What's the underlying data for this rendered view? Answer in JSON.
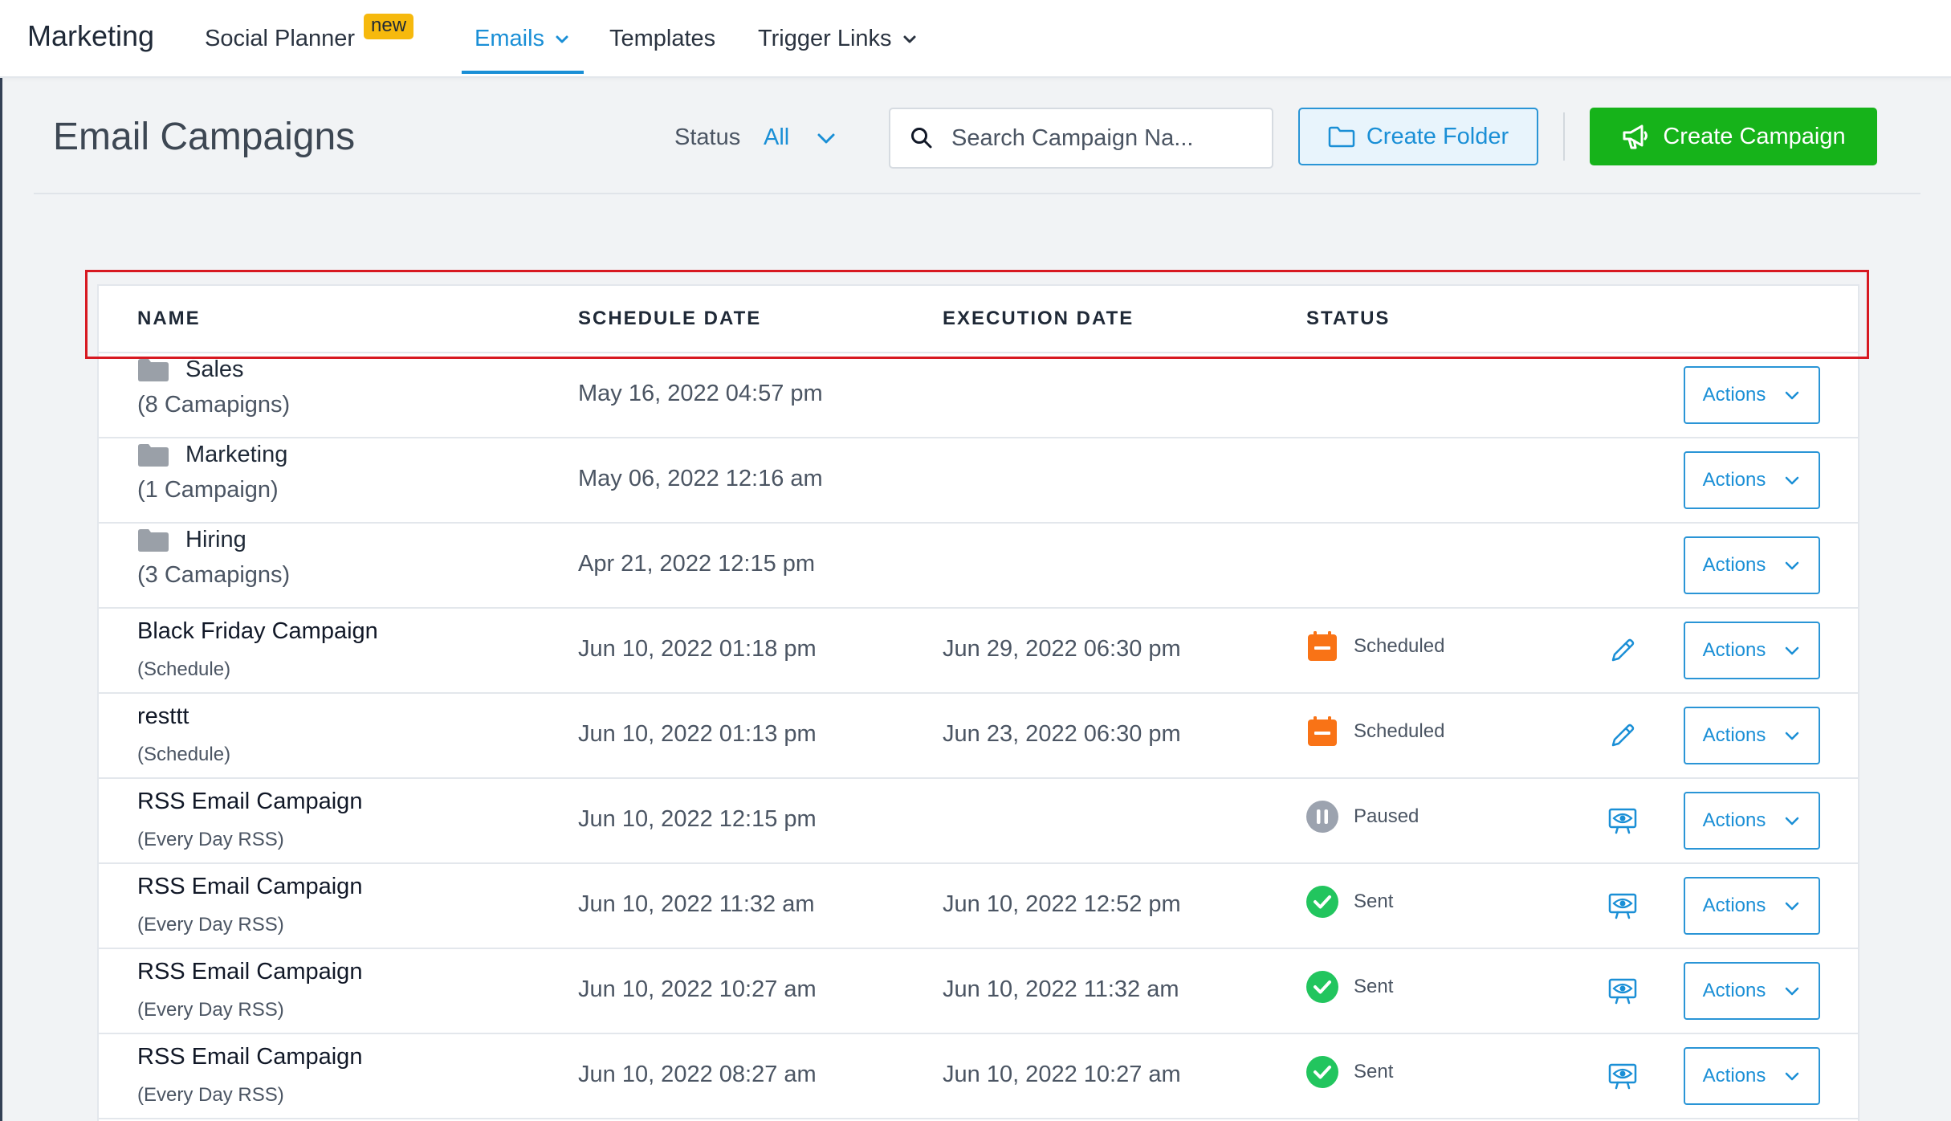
{
  "nav": {
    "brand": "Marketing",
    "social_planner": "Social Planner",
    "new_badge": "new",
    "emails": "Emails",
    "templates": "Templates",
    "trigger_links": "Trigger Links"
  },
  "header": {
    "title": "Email Campaigns",
    "status_label": "Status",
    "status_value": "All",
    "search_placeholder": "Search Campaign Na...",
    "create_folder": "Create Folder",
    "create_campaign": "Create Campaign"
  },
  "table": {
    "columns": [
      "NAME",
      "SCHEDULE DATE",
      "EXECUTION DATE",
      "STATUS"
    ],
    "actions_label": "Actions",
    "folders": [
      {
        "name": "Sales",
        "count": "(8 Camapigns)",
        "schedule": "May 16, 2022 04:57 pm"
      },
      {
        "name": "Marketing",
        "count": "(1 Campaign)",
        "schedule": "May 06, 2022 12:16 am"
      },
      {
        "name": "Hiring",
        "count": "(3 Camapigns)",
        "schedule": "Apr 21, 2022 12:15 pm"
      }
    ],
    "campaigns": [
      {
        "name": "Black Friday Campaign",
        "sub": "(Schedule)",
        "schedule": "Jun 10, 2022 01:18 pm",
        "execution": "Jun 29, 2022 06:30 pm",
        "status": "Scheduled",
        "row_icon": "pencil-icon"
      },
      {
        "name": "resttt",
        "sub": "(Schedule)",
        "schedule": "Jun 10, 2022 01:13 pm",
        "execution": "Jun 23, 2022 06:30 pm",
        "status": "Scheduled",
        "row_icon": "pencil-icon"
      },
      {
        "name": "RSS Email Campaign",
        "sub": "(Every Day RSS)",
        "schedule": "Jun 10, 2022 12:15 pm",
        "execution": "",
        "status": "Paused",
        "row_icon": "eye-icon"
      },
      {
        "name": "RSS Email Campaign",
        "sub": "(Every Day RSS)",
        "schedule": "Jun 10, 2022 11:32 am",
        "execution": "Jun 10, 2022 12:52 pm",
        "status": "Sent",
        "row_icon": "eye-icon"
      },
      {
        "name": "RSS Email Campaign",
        "sub": "(Every Day RSS)",
        "schedule": "Jun 10, 2022 10:27 am",
        "execution": "Jun 10, 2022 11:32 am",
        "status": "Sent",
        "row_icon": "eye-icon"
      },
      {
        "name": "RSS Email Campaign",
        "sub": "(Every Day RSS)",
        "schedule": "Jun 10, 2022 08:27 am",
        "execution": "Jun 10, 2022 10:27 am",
        "status": "Sent",
        "row_icon": "eye-icon"
      }
    ]
  },
  "colors": {
    "accent": "#1a8fd6",
    "create_green": "#16b31a",
    "badge_yellow": "#f6b90d",
    "scheduled_orange": "#f97316",
    "sent_green": "#22c55e",
    "paused_gray": "#9ca3af",
    "highlight_red": "#d71921"
  }
}
